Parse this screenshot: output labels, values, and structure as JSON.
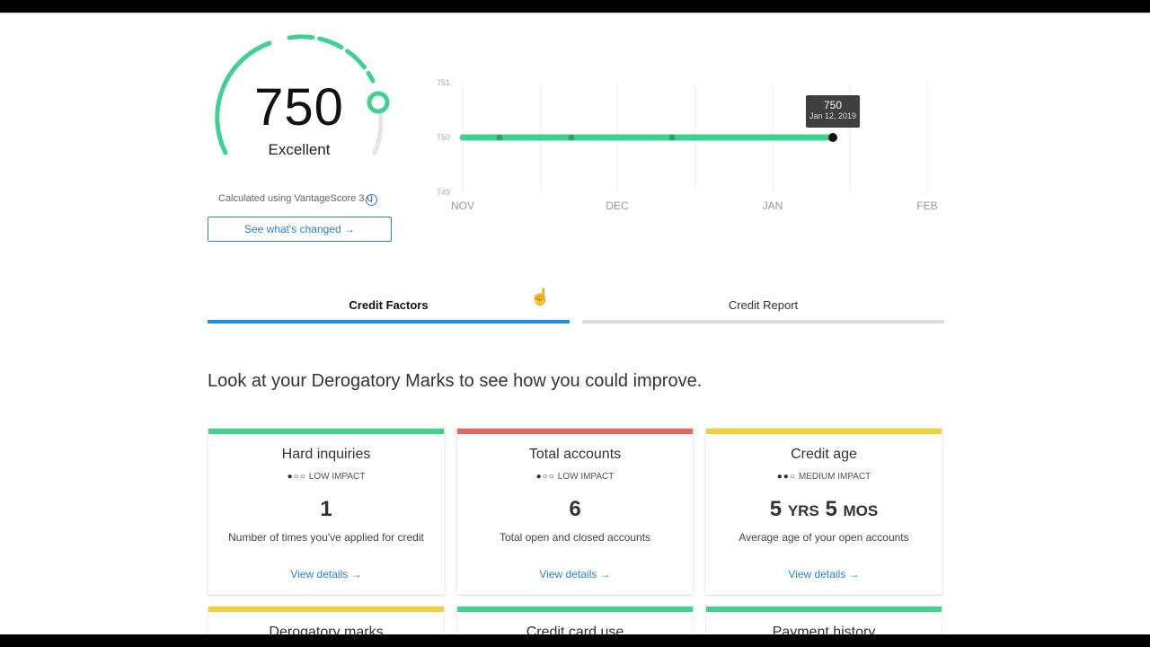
{
  "gauge": {
    "score": "750",
    "rating": "Excellent",
    "calculated_text": "Calculated using VantageScore 3.0",
    "info_glyph": "i",
    "changed_button": "See what's changed →",
    "accent": "#3fd28f"
  },
  "chart_data": {
    "type": "line",
    "x_tick_labels": [
      "NOV",
      "DEC",
      "JAN",
      "FEB"
    ],
    "y_tick_labels": [
      "751",
      "750",
      "749"
    ],
    "ylim": [
      749,
      751
    ],
    "series": [
      {
        "points": [
          750,
          750,
          750,
          750,
          750,
          750
        ]
      }
    ],
    "tooltip": {
      "value": "750",
      "date": "Jan 12, 2019"
    },
    "grid": "vertical",
    "color": "#3fd28f"
  },
  "tabs": [
    {
      "label": "Credit Factors",
      "active": true
    },
    {
      "label": "Credit Report",
      "active": false
    }
  ],
  "headline": "Look at your Derogatory Marks to see how you could improve.",
  "cards": [
    {
      "title": "Hard inquiries",
      "impact_dots": "●○○",
      "impact": "LOW IMPACT",
      "value": "1",
      "desc": "Number of times you've applied for credit",
      "link": "View details →",
      "color": "#3fd28f"
    },
    {
      "title": "Total accounts",
      "impact_dots": "●○○",
      "impact": "LOW IMPACT",
      "value": "6",
      "desc": "Total open and closed accounts",
      "link": "View details →",
      "color": "#e9625d"
    },
    {
      "title": "Credit age",
      "impact_dots": "●●○",
      "impact": "MEDIUM IMPACT",
      "value_years": "5",
      "unit_years": "YRS",
      "value_months": "5",
      "unit_months": "MOS",
      "desc": "Average age of your open accounts",
      "link": "View details →",
      "color": "#f2cf3b"
    }
  ],
  "cards_row2": [
    {
      "title": "Derogatory marks",
      "color": "#f2cf3b"
    },
    {
      "title": "Credit card use",
      "color": "#3fd28f"
    },
    {
      "title": "Payment history",
      "color": "#3fd28f"
    }
  ]
}
